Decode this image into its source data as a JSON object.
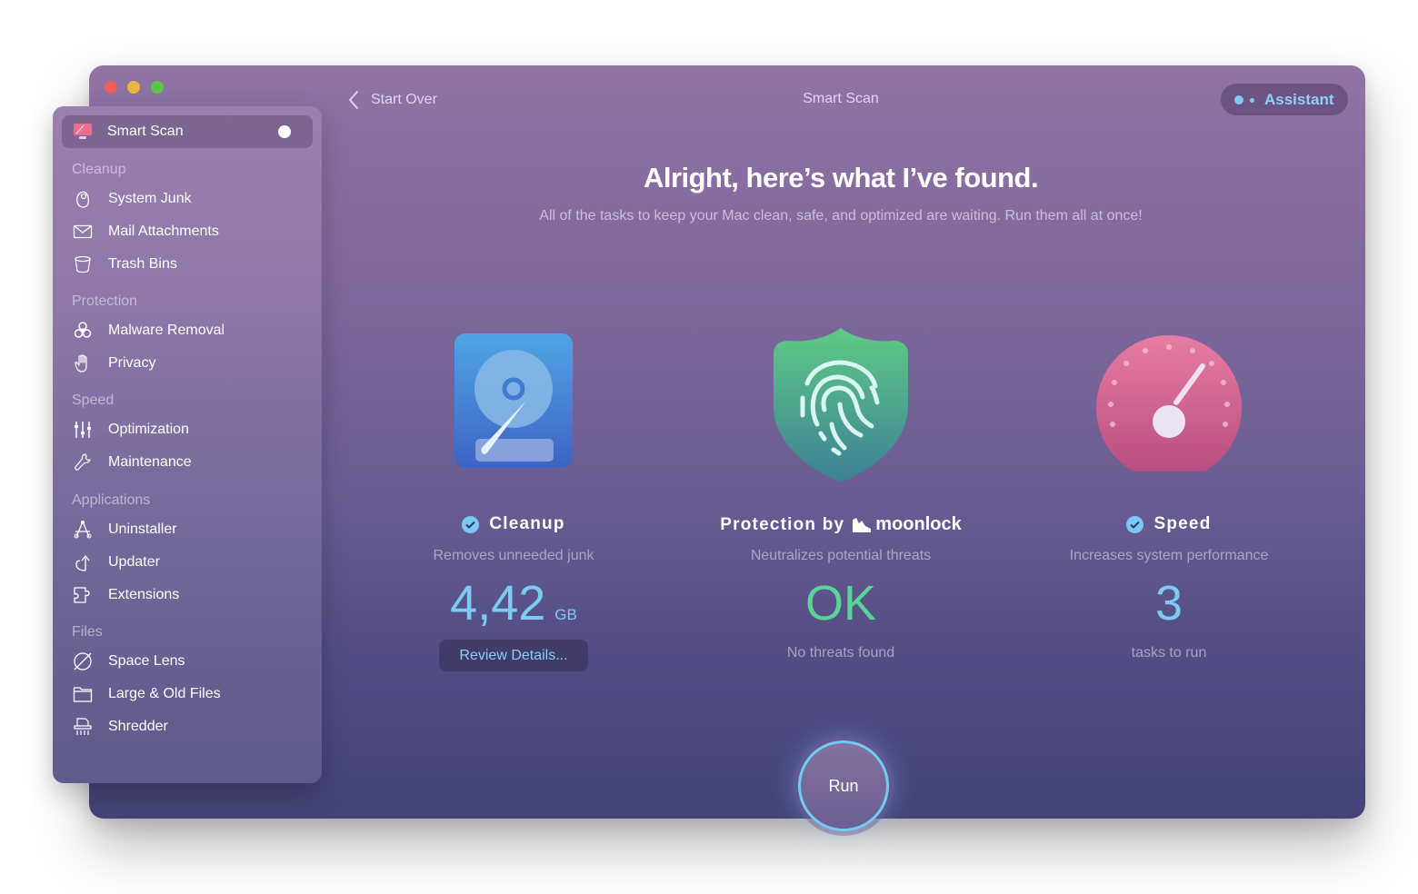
{
  "window": {
    "title": "Smart Scan",
    "back_label": "Start Over",
    "assistant_label": "Assistant"
  },
  "sidebar": {
    "active": {
      "label": "Smart Scan",
      "icon": "monitor-scan-icon"
    },
    "sections": [
      {
        "title": "Cleanup",
        "items": [
          {
            "label": "System Junk",
            "icon": "system-junk-icon"
          },
          {
            "label": "Mail Attachments",
            "icon": "mail-icon"
          },
          {
            "label": "Trash Bins",
            "icon": "trash-bin-icon"
          }
        ]
      },
      {
        "title": "Protection",
        "items": [
          {
            "label": "Malware Removal",
            "icon": "biohazard-icon"
          },
          {
            "label": "Privacy",
            "icon": "hand-icon"
          }
        ]
      },
      {
        "title": "Speed",
        "items": [
          {
            "label": "Optimization",
            "icon": "sliders-icon"
          },
          {
            "label": "Maintenance",
            "icon": "wrench-icon"
          }
        ]
      },
      {
        "title": "Applications",
        "items": [
          {
            "label": "Uninstaller",
            "icon": "uninstaller-icon"
          },
          {
            "label": "Updater",
            "icon": "updater-arrow-icon"
          },
          {
            "label": "Extensions",
            "icon": "puzzle-icon"
          }
        ]
      },
      {
        "title": "Files",
        "items": [
          {
            "label": "Space Lens",
            "icon": "planet-icon"
          },
          {
            "label": "Large & Old Files",
            "icon": "folder-icon"
          },
          {
            "label": "Shredder",
            "icon": "shredder-icon"
          }
        ]
      }
    ]
  },
  "main": {
    "headline": "Alright, here’s what I’ve found.",
    "subline": "All of the tasks to keep your Mac clean, safe, and optimized are waiting. Run them all at once!",
    "cleanup": {
      "title": "Cleanup",
      "checked": true,
      "description": "Removes unneeded junk",
      "value": "4,42",
      "unit": "GB",
      "button": "Review Details..."
    },
    "protection": {
      "title": "Protection by",
      "brand": "moonlock",
      "description": "Neutralizes potential threats",
      "value": "OK",
      "note": "No threats found"
    },
    "speed": {
      "title": "Speed",
      "checked": true,
      "description": "Increases system performance",
      "value": "3",
      "note": "tasks to run"
    },
    "run_label": "Run"
  },
  "colors": {
    "accent_blue": "#7ccbf4",
    "status_green": "#5ad59a",
    "traffic_close": "#ec5f57",
    "traffic_min": "#e7b53c",
    "traffic_max": "#5cc548"
  }
}
